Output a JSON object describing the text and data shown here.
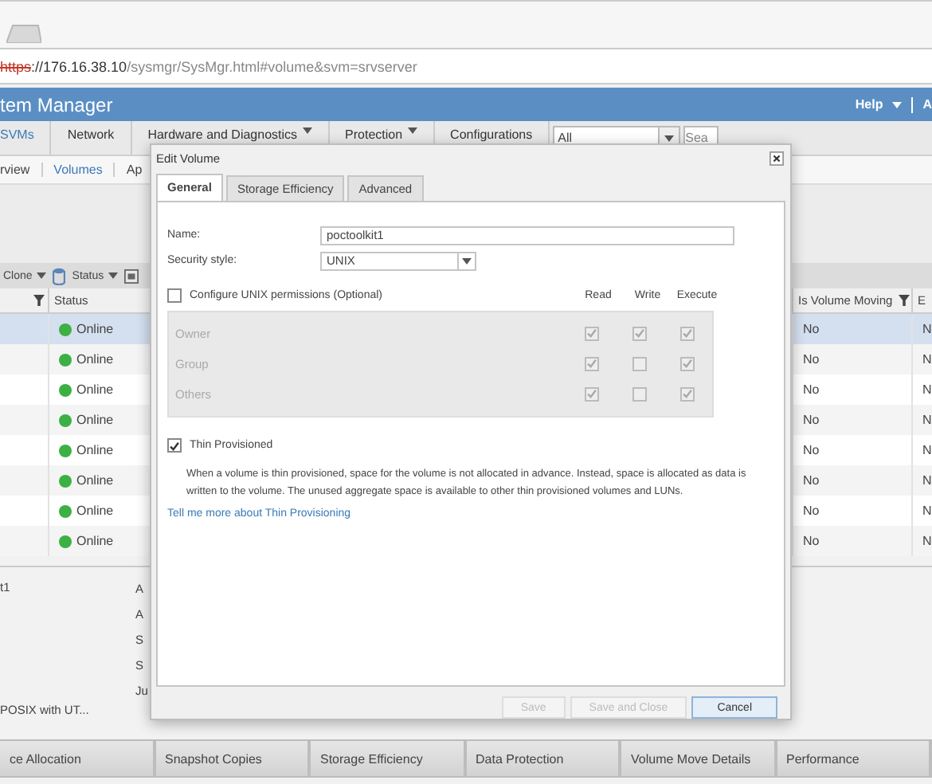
{
  "browser": {
    "url_scheme": "https",
    "url_host": "://176.16.38.10",
    "url_path": "/sysmgr/SysMgr.html#volume&svm=srvserver"
  },
  "app_header": {
    "title": "tem Manager",
    "help": "Help",
    "user": "A"
  },
  "nav": [
    {
      "label": "SVMs",
      "selected": true,
      "menu": false
    },
    {
      "label": "Network",
      "selected": false,
      "menu": false
    },
    {
      "label": "Hardware and Diagnostics",
      "selected": false,
      "menu": true
    },
    {
      "label": "Protection",
      "selected": false,
      "menu": true
    },
    {
      "label": "Configurations",
      "selected": false,
      "menu": false
    }
  ],
  "scope": {
    "value": "All",
    "search_placeholder": "Sea"
  },
  "subtabs": [
    {
      "label": "rview",
      "selected": false
    },
    {
      "label": "Volumes",
      "selected": true
    },
    {
      "label": "Ap",
      "selected": false
    }
  ],
  "toolbar": [
    {
      "label": "Clone"
    },
    {
      "label": "Status"
    }
  ],
  "table": {
    "columns": [
      "Status",
      "Is Volume Moving",
      "E"
    ],
    "rows": [
      {
        "selected": true,
        "status": "Online",
        "moving": "No",
        "column_3": "N"
      },
      {
        "selected": false,
        "status": "Online",
        "moving": "No",
        "column_3": "N"
      },
      {
        "selected": false,
        "status": "Online",
        "moving": "No",
        "column_3": "N"
      },
      {
        "selected": false,
        "status": "Online",
        "moving": "No",
        "column_3": "N"
      },
      {
        "selected": false,
        "status": "Online",
        "moving": "No",
        "column_3": "N"
      },
      {
        "selected": false,
        "status": "Online",
        "moving": "No",
        "column_3": "N"
      },
      {
        "selected": false,
        "status": "Online",
        "moving": "No",
        "column_3": "N"
      },
      {
        "selected": false,
        "status": "Online",
        "moving": "No",
        "column_3": "N"
      }
    ]
  },
  "details": {
    "left": [
      "t1",
      "POSIX with UT..."
    ],
    "middle": [
      "A",
      "A",
      "S",
      "S",
      "Ju"
    ]
  },
  "bottom_tabs": [
    {
      "label": "ce Allocation",
      "selected": false
    },
    {
      "label": "Snapshot Copies",
      "selected": false
    },
    {
      "label": "Storage Efficiency",
      "selected": false
    },
    {
      "label": "Data Protection",
      "selected": false
    },
    {
      "label": "Volume Move Details",
      "selected": false
    },
    {
      "label": "Performance",
      "selected": false
    }
  ],
  "dialog": {
    "title": "Edit Volume",
    "tabs": [
      {
        "label": "General",
        "selected": true
      },
      {
        "label": "Storage Efficiency",
        "selected": false
      },
      {
        "label": "Advanced",
        "selected": false
      }
    ],
    "name_label": "Name:",
    "name_value": "poctoolkit1",
    "security_label": "Security style:",
    "security_value": "UNIX",
    "configure": {
      "label": "Configure UNIX permissions (Optional)",
      "checked": false
    },
    "permission_columns": [
      "Read",
      "Write",
      "Execute"
    ],
    "permissions_disabled": true,
    "permissions": [
      {
        "label": "Owner",
        "read": true,
        "write": true,
        "execute": true
      },
      {
        "label": "Group",
        "read": true,
        "write": false,
        "execute": true
      },
      {
        "label": "Others",
        "read": true,
        "write": false,
        "execute": true
      }
    ],
    "thin": {
      "label": "Thin Provisioned",
      "checked": true
    },
    "description": "When a volume is thin provisioned, space for the volume is not allocated in advance. Instead, space is allocated as data is written to the volume. The unused aggregate space is available to other thin provisioned volumes and LUNs.",
    "link": "Tell me more about Thin Provisioning",
    "buttons": [
      {
        "label": "Save",
        "disabled": true
      },
      {
        "label": "Save and Close",
        "disabled": true
      },
      {
        "label": "Cancel",
        "disabled": false
      }
    ]
  }
}
